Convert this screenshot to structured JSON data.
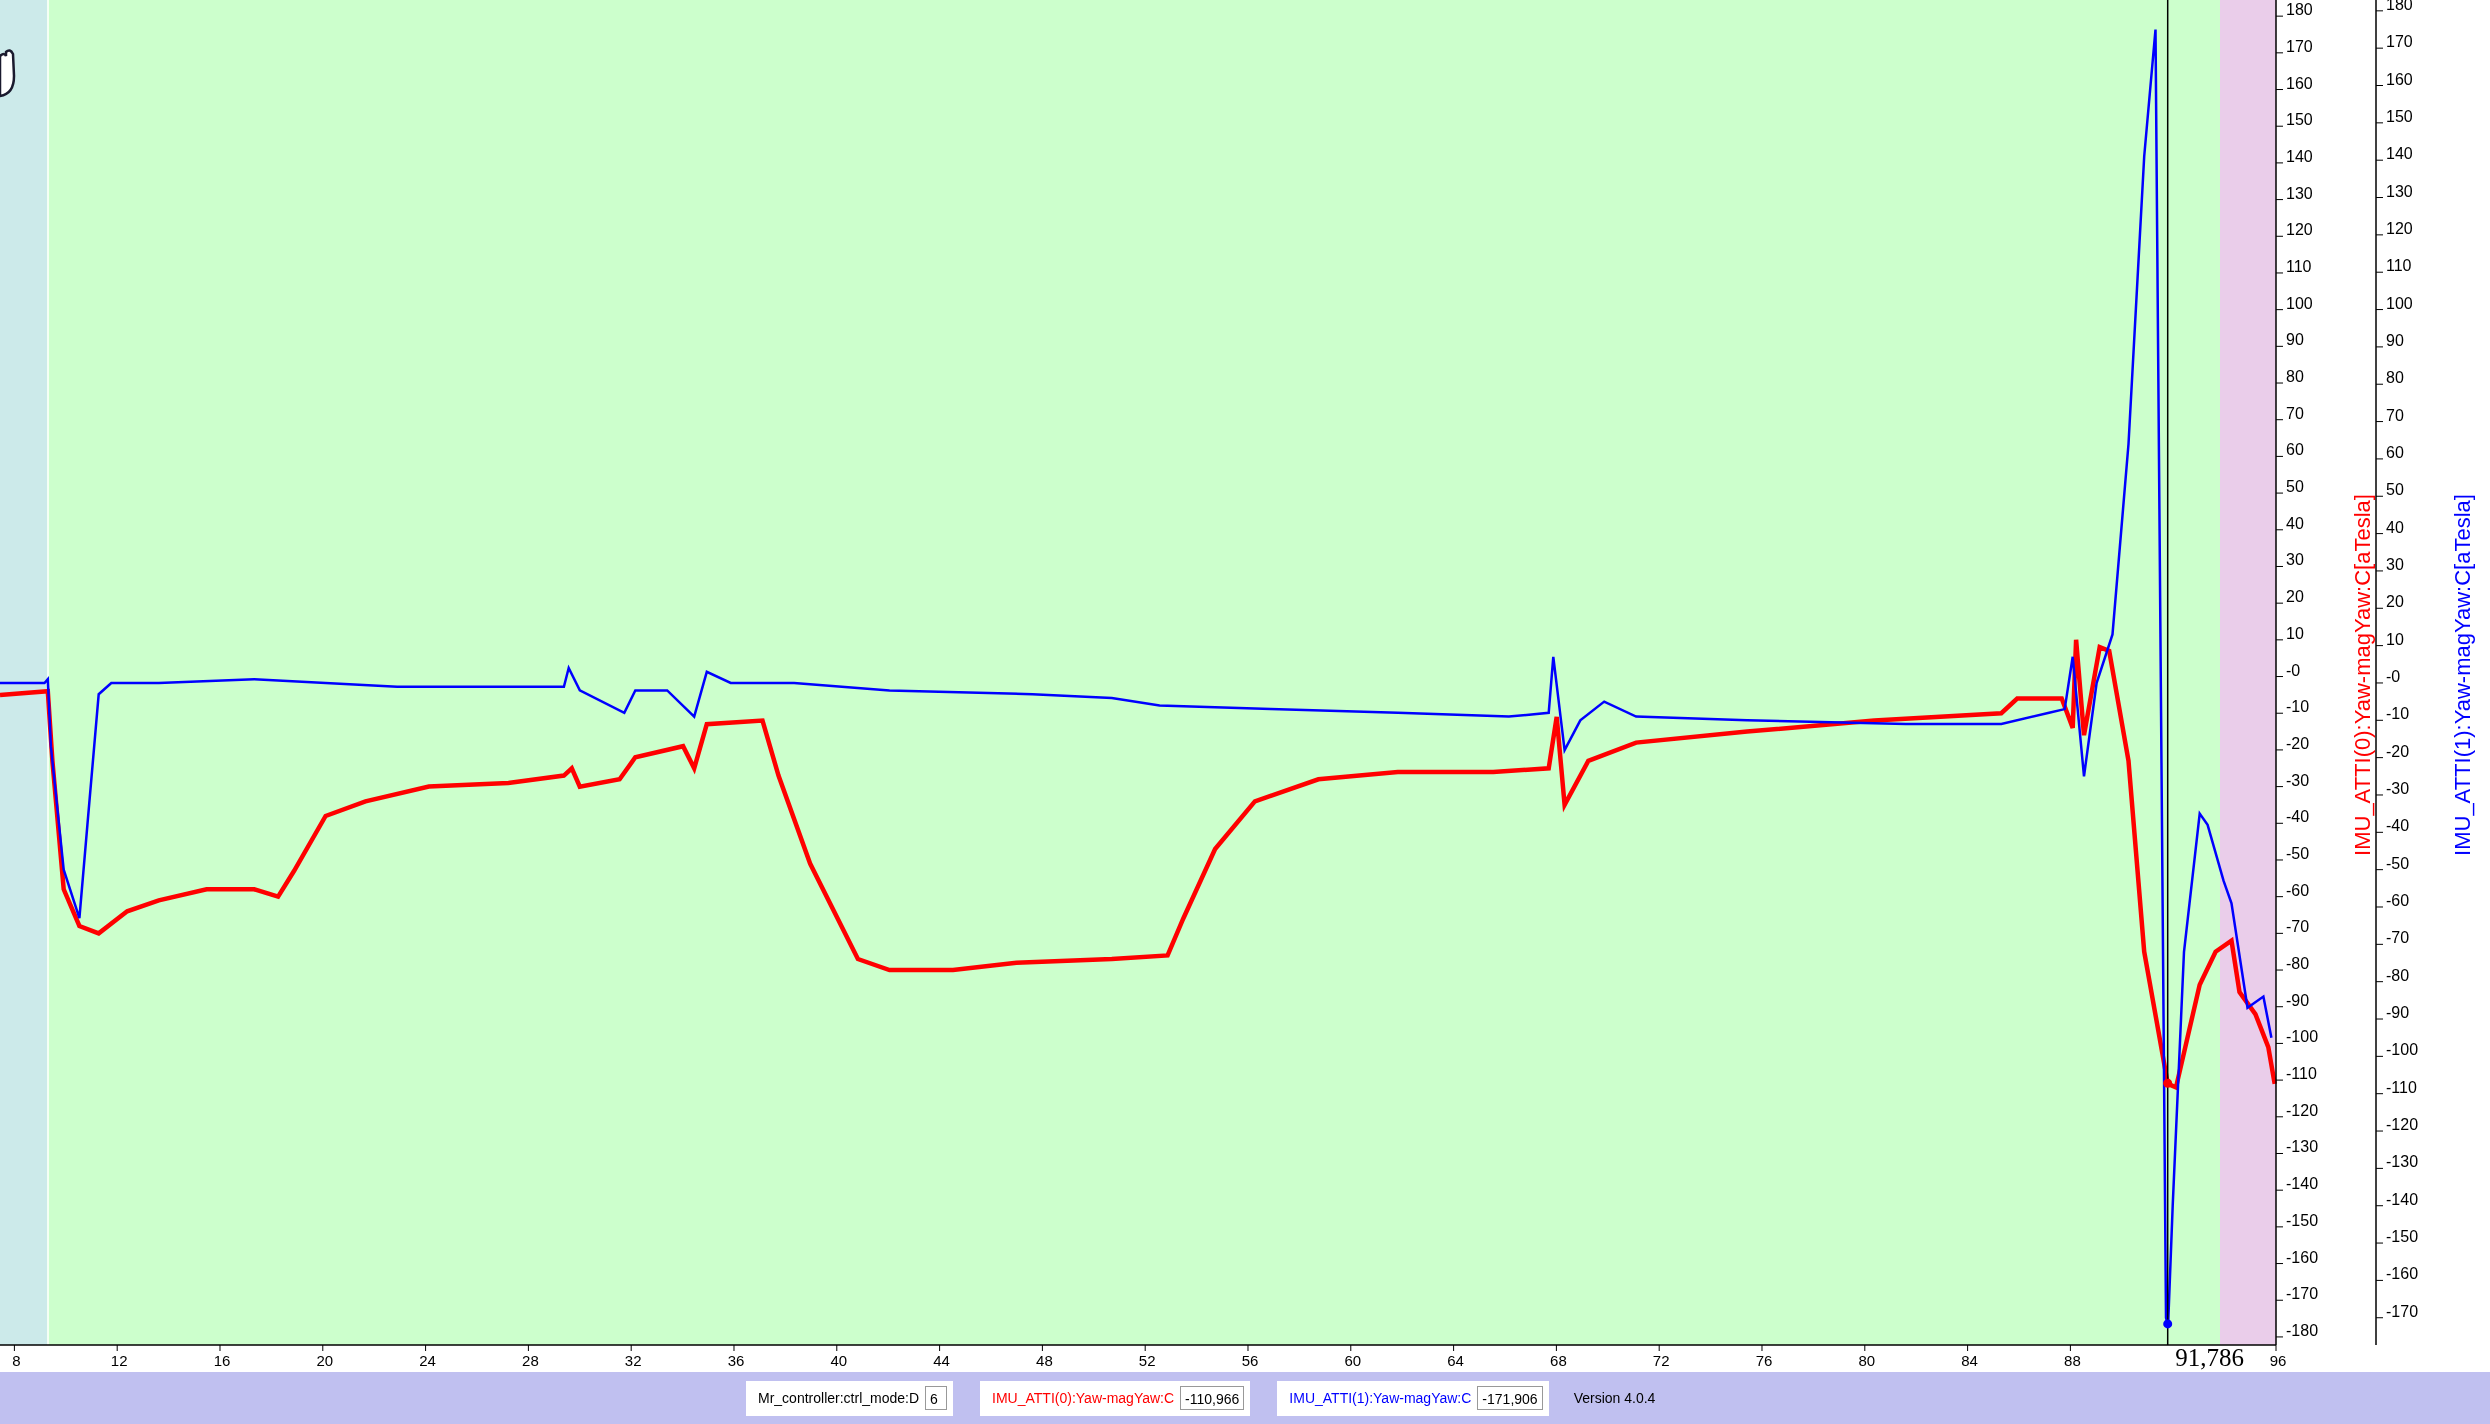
{
  "chart": {
    "chart_data": {
      "type": "line",
      "xlim": [
        7.44,
        96
      ],
      "ylim": [
        -182.2,
        184.4
      ],
      "xticks": [
        8,
        12,
        16,
        20,
        24,
        28,
        32,
        36,
        40,
        44,
        48,
        52,
        56,
        60,
        64,
        68,
        72,
        76,
        80,
        84,
        88,
        96
      ],
      "y2lim": [
        -177.3,
        182.9
      ],
      "yticks": [
        {
          "value": -180,
          "label": "-180"
        },
        {
          "value": -170,
          "label": "-170"
        },
        {
          "value": -160,
          "label": "-160"
        },
        {
          "value": -150,
          "label": "-150"
        },
        {
          "value": -140,
          "label": "-140"
        },
        {
          "value": -130,
          "label": "-130"
        },
        {
          "value": -120,
          "label": "-120"
        },
        {
          "value": -110,
          "label": "-110"
        },
        {
          "value": -100,
          "label": "-100"
        },
        {
          "value": -90,
          "label": "-90"
        },
        {
          "value": -80,
          "label": "-80"
        },
        {
          "value": -70,
          "label": "-70"
        },
        {
          "value": -60,
          "label": "-60"
        },
        {
          "value": -50,
          "label": "-50"
        },
        {
          "value": -40,
          "label": "-40"
        },
        {
          "value": -30,
          "label": "-30"
        },
        {
          "value": -20,
          "label": "-20"
        },
        {
          "value": -10,
          "label": "-10"
        },
        {
          "value": 0,
          "label": "-0"
        },
        {
          "value": 10,
          "label": "10"
        },
        {
          "value": 20,
          "label": "20"
        },
        {
          "value": 30,
          "label": "30"
        },
        {
          "value": 40,
          "label": "40"
        },
        {
          "value": 50,
          "label": "50"
        },
        {
          "value": 60,
          "label": "60"
        },
        {
          "value": 70,
          "label": "70"
        },
        {
          "value": 80,
          "label": "80"
        },
        {
          "value": 90,
          "label": "90"
        },
        {
          "value": 100,
          "label": "100"
        },
        {
          "value": 110,
          "label": "110"
        },
        {
          "value": 120,
          "label": "120"
        },
        {
          "value": 130,
          "label": "130"
        },
        {
          "value": 140,
          "label": "140"
        },
        {
          "value": 150,
          "label": "150"
        },
        {
          "value": 160,
          "label": "160"
        },
        {
          "value": 170,
          "label": "170"
        },
        {
          "value": 180,
          "label": "180"
        }
      ],
      "y2ticks": [
        {
          "value": -170,
          "label": "-170"
        },
        {
          "value": -160,
          "label": "-160"
        },
        {
          "value": -150,
          "label": "-150"
        },
        {
          "value": -140,
          "label": "-140"
        },
        {
          "value": -130,
          "label": "-130"
        },
        {
          "value": -120,
          "label": "-120"
        },
        {
          "value": -110,
          "label": "-110"
        },
        {
          "value": -100,
          "label": "-100"
        },
        {
          "value": -90,
          "label": "-90"
        },
        {
          "value": -80,
          "label": "-80"
        },
        {
          "value": -70,
          "label": "-70"
        },
        {
          "value": -60,
          "label": "-60"
        },
        {
          "value": -50,
          "label": "-50"
        },
        {
          "value": -40,
          "label": "-40"
        },
        {
          "value": -30,
          "label": "-30"
        },
        {
          "value": -20,
          "label": "-20"
        },
        {
          "value": -10,
          "label": "-10"
        },
        {
          "value": 0,
          "label": "-0"
        },
        {
          "value": 10,
          "label": "10"
        },
        {
          "value": 20,
          "label": "20"
        },
        {
          "value": 30,
          "label": "30"
        },
        {
          "value": 40,
          "label": "40"
        },
        {
          "value": 50,
          "label": "50"
        },
        {
          "value": 60,
          "label": "60"
        },
        {
          "value": 70,
          "label": "70"
        },
        {
          "value": 80,
          "label": "80"
        },
        {
          "value": 90,
          "label": "90"
        },
        {
          "value": 100,
          "label": "100"
        },
        {
          "value": 110,
          "label": "110"
        },
        {
          "value": 120,
          "label": "120"
        },
        {
          "value": 130,
          "label": "130"
        },
        {
          "value": 140,
          "label": "140"
        },
        {
          "value": 150,
          "label": "150"
        },
        {
          "value": 160,
          "label": "160"
        },
        {
          "value": 170,
          "label": "170"
        },
        {
          "value": 180,
          "label": "180"
        }
      ],
      "ref_lines": [
        {
          "axis": "x",
          "value": 91.786,
          "label": "91,786"
        }
      ],
      "series": [
        {
          "name": "IMU_ATTI(0):Yaw-magYaw:C[aTesla]",
          "color": "#ff0000",
          "x": [
            7.44,
            9.3,
            9.48,
            9.92,
            10.53,
            11.28,
            12.39,
            13.62,
            15.48,
            17.33,
            18.26,
            18.88,
            20.11,
            21.66,
            24.13,
            27.22,
            29.38,
            29.69,
            30.0,
            31.55,
            32.16,
            34.02,
            34.45,
            34.94,
            37.11,
            37.73,
            38.96,
            40.82,
            42.05,
            44.52,
            46.99,
            50.7,
            52.87,
            53.48,
            54.72,
            56.27,
            58.74,
            61.83,
            65.54,
            67.7,
            68.01,
            68.32,
            69.24,
            71.1,
            75.42,
            80.37,
            85.31,
            85.93,
            87.66,
            88.09,
            88.22,
            88.53,
            89.14,
            89.51,
            90.26,
            90.87,
            91.79,
            92.11,
            93.03,
            93.65,
            94.27,
            94.58,
            95.2,
            95.7,
            95.95
          ],
          "values": [
            -5,
            -4,
            -23,
            -58,
            -68,
            -70,
            -64,
            -61,
            -58,
            -58,
            -60,
            -53,
            -38,
            -34,
            -30,
            -29,
            -27,
            -25,
            -30,
            -28,
            -22,
            -19,
            -25,
            -13,
            -12,
            -27,
            -51,
            -77,
            -80,
            -80,
            -78,
            -77,
            -76,
            -66,
            -47,
            -34,
            -28,
            -26,
            -26,
            -25,
            -11,
            -35,
            -23,
            -18,
            -15,
            -12,
            -10,
            -6,
            -6,
            -14,
            10,
            -16,
            8,
            7,
            -23,
            -75,
            -111,
            -112,
            -84,
            -75,
            -72,
            -86,
            -92,
            -101,
            -111
          ]
        },
        {
          "name": "IMU_ATTI(1):Yaw-magYaw:C[aTesla]",
          "color": "#0000ff",
          "axis": "y2",
          "x": [
            7.44,
            9.17,
            9.3,
            9.42,
            9.92,
            10.53,
            10.84,
            11.28,
            11.77,
            13.62,
            17.33,
            22.89,
            29.38,
            29.57,
            30.0,
            31.73,
            32.16,
            33.4,
            34.45,
            34.94,
            35.87,
            38.34,
            42.05,
            47.61,
            50.7,
            52.56,
            56.88,
            61.83,
            66.15,
            67.7,
            67.88,
            68.32,
            68.93,
            69.86,
            71.1,
            75.42,
            81.6,
            85.31,
            87.17,
            87.78,
            88.09,
            88.53,
            89.02,
            89.64,
            90.26,
            90.87,
            91.31,
            91.72,
            91.8,
            91.98,
            92.42,
            93.03,
            93.34,
            93.96,
            94.27,
            94.89,
            95.51,
            95.82
          ],
          "values": [
            0,
            0,
            1,
            -17,
            -50,
            -63,
            -38,
            -3,
            0,
            0,
            1,
            -1,
            -1,
            4,
            -2,
            -8,
            -2,
            -2,
            -9,
            3,
            0,
            0,
            -2,
            -3,
            -4,
            -6,
            -7,
            -8,
            -9,
            -8,
            7,
            -18,
            -10,
            -5,
            -9,
            -10,
            -11,
            -11,
            -8,
            -7,
            7,
            -25,
            0,
            13,
            64,
            141,
            175,
            -170,
            -172,
            -140,
            -72,
            -35,
            -38,
            -53,
            -59,
            -87,
            -84,
            -95
          ]
        }
      ]
    }
  },
  "status_bar": {
    "fields": [
      {
        "label": "Mr_controller:ctrl_mode:D",
        "value": "6",
        "color": "#000000"
      },
      {
        "label": "IMU_ATTI(0):Yaw-magYaw:C",
        "value": "-110,966",
        "color": "#ff0000"
      },
      {
        "label": "IMU_ATTI(1):Yaw-magYaw:C",
        "value": "-171,906",
        "color": "#0000ff"
      }
    ],
    "version": "Version 4.0.4"
  }
}
